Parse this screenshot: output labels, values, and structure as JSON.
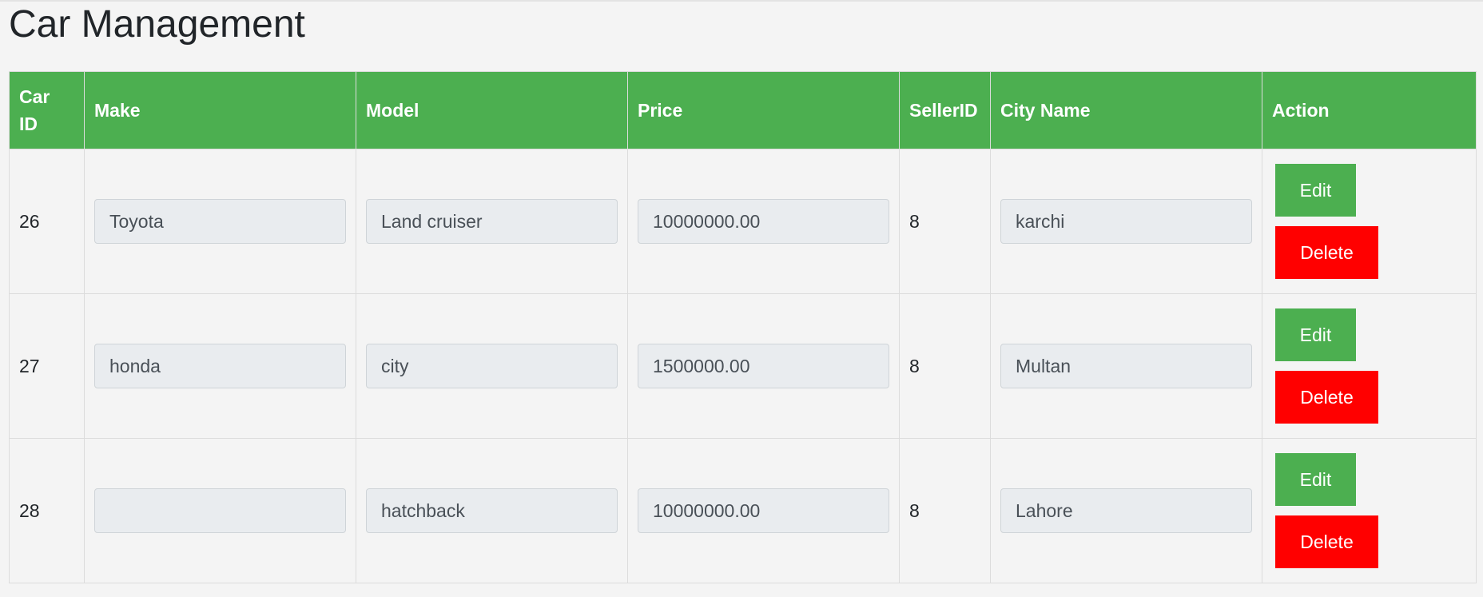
{
  "page": {
    "title": "Car Management"
  },
  "colors": {
    "header_bg": "#4caf50",
    "edit_button": "#4caf50",
    "delete_button": "#ff0000"
  },
  "table": {
    "headers": [
      "Car ID",
      "Make",
      "Model",
      "Price",
      "SellerID",
      "City Name",
      "Action"
    ],
    "rows": [
      {
        "car_id": "26",
        "make": "Toyota",
        "model": "Land cruiser",
        "price": "10000000.00",
        "seller_id": "8",
        "city": "karchi"
      },
      {
        "car_id": "27",
        "make": "honda",
        "model": "city",
        "price": "1500000.00",
        "seller_id": "8",
        "city": "Multan"
      },
      {
        "car_id": "28",
        "make": "",
        "model": "hatchback",
        "price": "10000000.00",
        "seller_id": "8",
        "city": "Lahore"
      }
    ],
    "edit_label": "Edit",
    "delete_label": "Delete"
  }
}
